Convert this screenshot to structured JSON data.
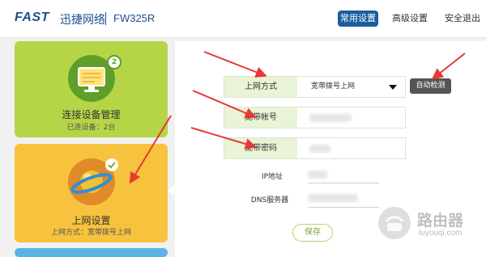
{
  "header": {
    "logo": "FAST",
    "brand_cn": "迅捷网络",
    "model": "FW325R",
    "nav": {
      "common": "常用设置",
      "advanced": "高级设置",
      "logout": "安全退出"
    }
  },
  "cards": {
    "devices": {
      "title": "连接设备管理",
      "subtitle": "已连设备：2台",
      "badge": "2",
      "color": "#b5d547"
    },
    "network": {
      "title": "上网设置",
      "subtitle": "上网方式：宽带拨号上网",
      "color": "#f7c23d"
    }
  },
  "form": {
    "connection_type": {
      "label": "上网方式",
      "value": "宽带拨号上网"
    },
    "auto_detect": "自动检测",
    "account": {
      "label": "宽带帐号"
    },
    "password": {
      "label": "宽带密码"
    },
    "ip": {
      "label": "IP地址"
    },
    "dns": {
      "label": "DNS服务器"
    },
    "save": "保存"
  },
  "watermark": {
    "text": "路由器",
    "url": "luyouqi.com"
  },
  "colors": {
    "accent": "#1b5e9f",
    "arrow": "#e53935"
  }
}
